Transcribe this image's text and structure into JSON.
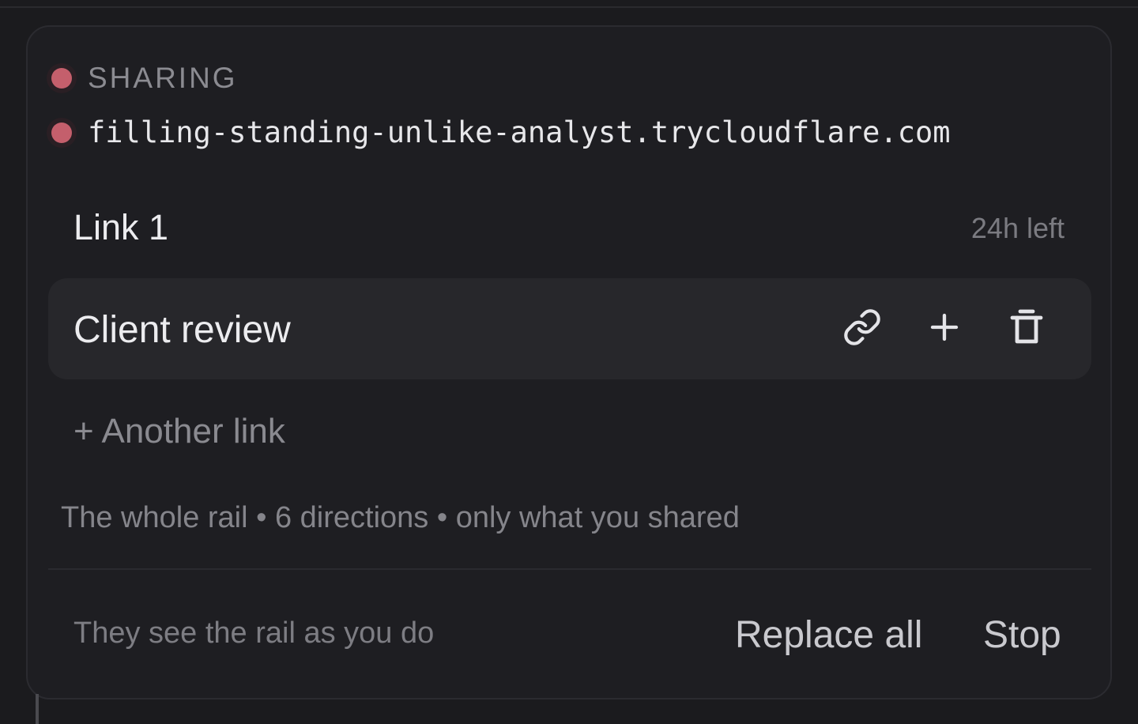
{
  "share_panel": {
    "status_label": "SHARING",
    "url": "filling-standing-unlike-analyst.trycloudflare.com",
    "status_color": "#c45f6c"
  },
  "link": {
    "name": "Link 1",
    "time_left": "24h left",
    "card": {
      "title": "Client review",
      "icons": [
        "link-icon",
        "plus-icon",
        "trash-icon"
      ]
    }
  },
  "another_link_label": "+ Another link",
  "summary_text": "The whole rail • 6 directions • only what you shared",
  "footer": {
    "note": "They see the rail as you do",
    "replace_all_label": "Replace all",
    "stop_label": "Stop"
  }
}
